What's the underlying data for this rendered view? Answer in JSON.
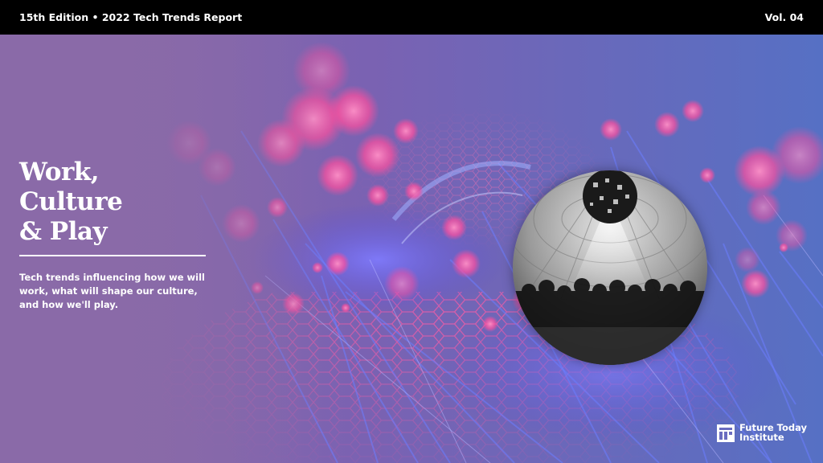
{
  "header": {
    "edition": "15th Edition • 2022 Tech Trends Report",
    "volume": "Vol. 04"
  },
  "title_lines": [
    "Work,",
    "Culture",
    "& Play"
  ],
  "subtitle": "Tech trends influencing how we will work, what will shape our culture, and how we'll play.",
  "logo": {
    "line1": "Future Today",
    "line2": "Institute",
    "icon": "institute-logo-icon"
  },
  "colors": {
    "header_bg": "#000000",
    "bg_left": "#8a6aa8",
    "bg_right": "#5b6fc4",
    "bokeh_pink": "#ff5fa8",
    "fiber_blue": "#5a6cff",
    "text": "#ffffff"
  }
}
